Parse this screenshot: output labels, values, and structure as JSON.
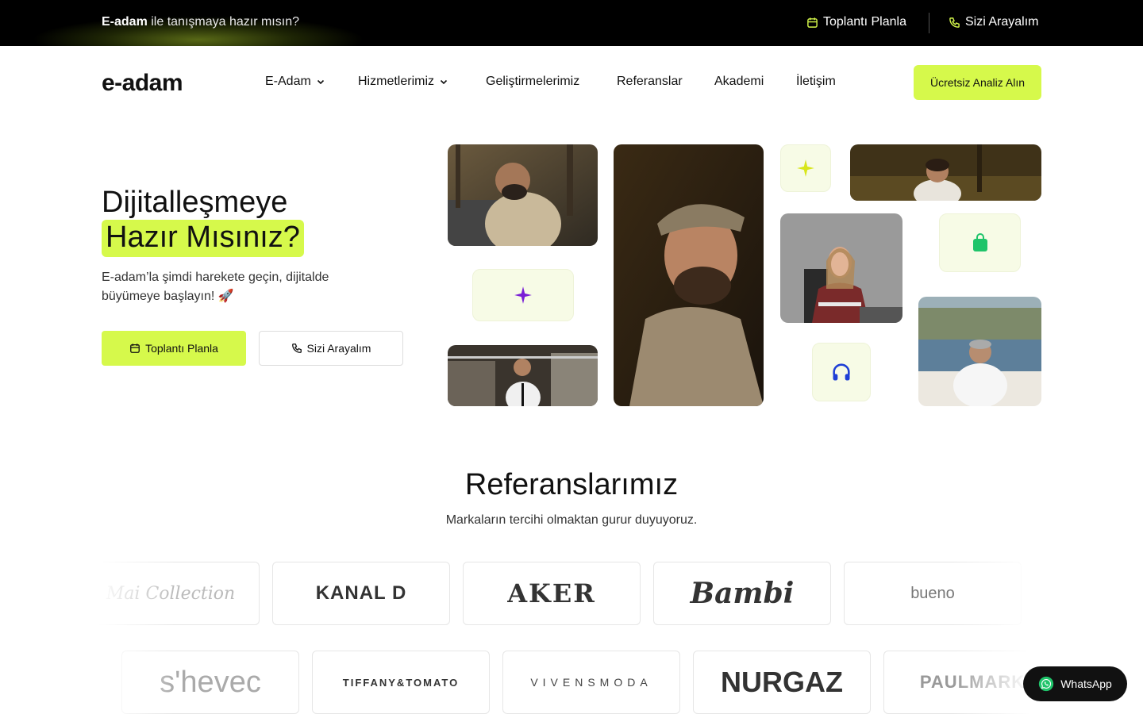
{
  "topbar": {
    "promo_bold": "E-adam",
    "promo_rest": " ile tanışmaya hazır mısın?",
    "meeting_label": "Toplantı Planla",
    "call_label": "Sizi Arayalım"
  },
  "header": {
    "logo": "e-adam",
    "nav": [
      {
        "label": "E-Adam",
        "dropdown": true
      },
      {
        "label": "Hizmetlerimiz",
        "dropdown": true
      },
      {
        "label": "Geliştirmelerimiz",
        "dropdown": false
      },
      {
        "label": "Referanslar",
        "dropdown": false
      },
      {
        "label": "Akademi",
        "dropdown": false
      },
      {
        "label": "İletişim",
        "dropdown": false
      }
    ],
    "cta_label": "Ücretsiz Analiz Alın"
  },
  "hero": {
    "title_line1": "Dijitalleşmeye",
    "title_line2": "Hazır Mısınız?",
    "subtitle": "E-adam’la şimdi harekete geçin, dijitalde büyümeye başlayın! 🚀",
    "primary_button": "Toplantı Planla",
    "secondary_button": "Sizi Arayalım"
  },
  "references": {
    "title": "Referanslarımız",
    "subtitle": "Markaların tercihi olmaktan gurur duyuyoruz.",
    "row1": [
      "Mai Collection",
      "KANAL D",
      "AKER",
      "Bambi",
      "bueno"
    ],
    "row2": [
      "s'hevec",
      "TIFFANY&TOMATO",
      "VIVENSMODA",
      "NURGAZ",
      "PAULMARK"
    ]
  },
  "whatsapp": {
    "label": "WhatsApp"
  },
  "colors": {
    "accent": "#d6f94b",
    "dark": "#000000",
    "purple": "#7a1fd6",
    "green": "#1fc46a",
    "blue": "#1f3fd6"
  },
  "icons": [
    "calendar-icon",
    "phone-icon",
    "chevron-down-icon",
    "sparkle-icon",
    "shopping-bag-icon",
    "headphones-icon",
    "whatsapp-icon"
  ]
}
